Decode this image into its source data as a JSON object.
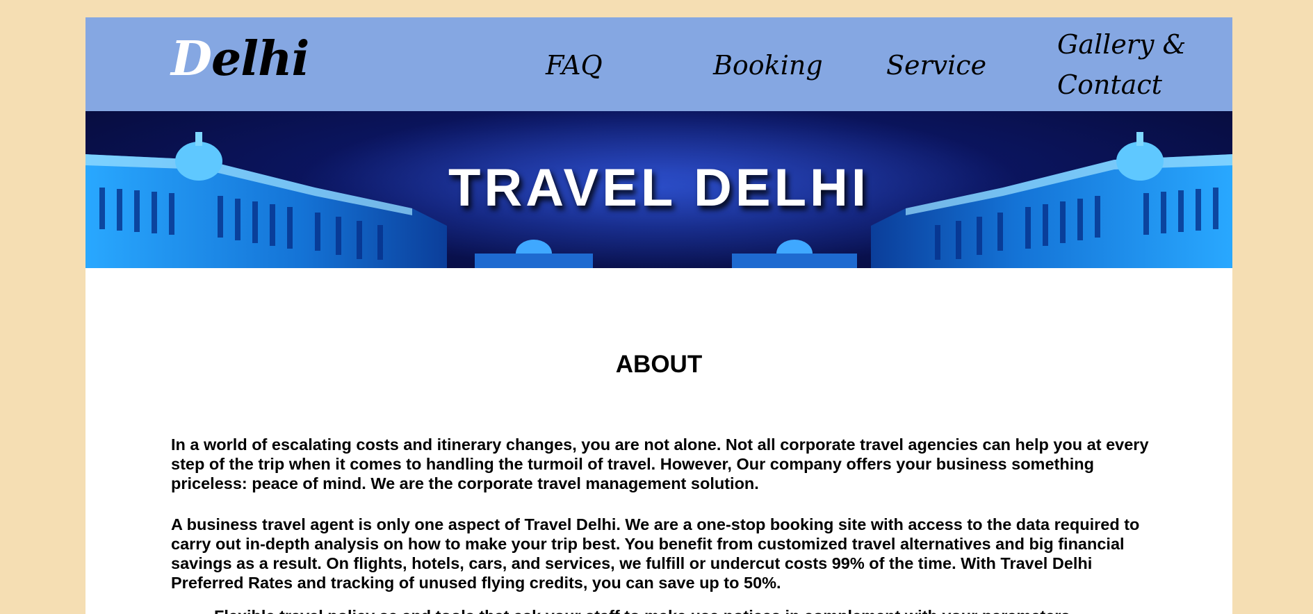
{
  "header": {
    "logo_first_letter": "D",
    "logo_rest": "elhi",
    "nav": [
      {
        "label": "FAQ"
      },
      {
        "label": "Booking"
      },
      {
        "label": "Service"
      },
      {
        "label": "Gallery & Contact"
      }
    ]
  },
  "hero": {
    "title": "TRAVEL DELHI"
  },
  "about": {
    "heading": "ABOUT",
    "paragraphs": [
      "In a world of escalating costs and itinerary changes, you are not alone. Not all corporate travel agencies can help you at every step of the trip when it comes to handling the turmoil of travel. However, Our company offers your business something priceless: peace of mind. We are the corporate travel management solution.",
      "A business travel agent is only one aspect of Travel Delhi. We are a one-stop booking site with access to the data required to carry out in-depth analysis on how to make your trip best. You benefit from customized travel alternatives and big financial savings as a result. On flights, hotels, cars, and services, we fulfill or undercut costs 99% of the time. With Travel Delhi Preferred Rates and tracking of unused flying credits, you can save up to 50%.",
      "Flexible travel policy se and tools that ask your staff to make use notices in complement with your parameters"
    ]
  },
  "colors": {
    "page_background": "#f5deb3",
    "nav_background": "#85a7e2",
    "content_background": "#ffffff",
    "hero_background": "#0b1560"
  }
}
